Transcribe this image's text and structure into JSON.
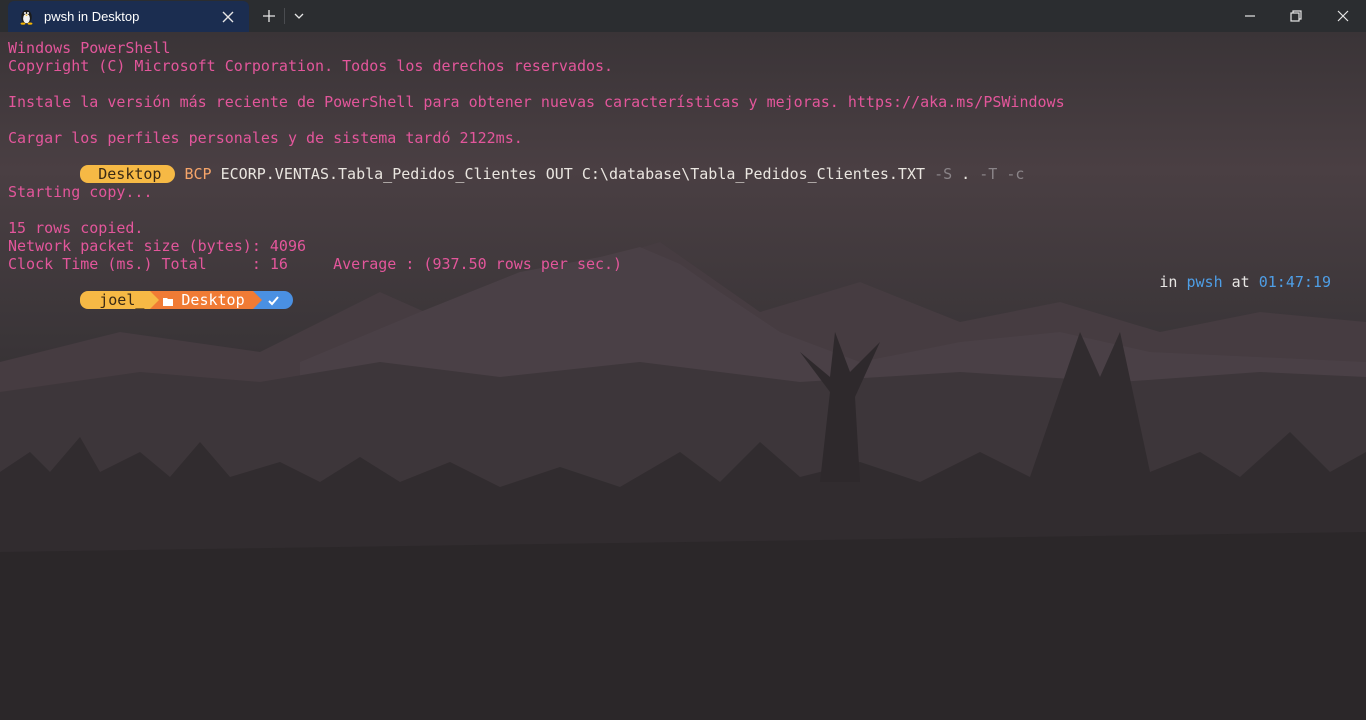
{
  "tab": {
    "title": "pwsh in Desktop",
    "icon": "linux-penguin-icon"
  },
  "titlebar": {
    "new_tab_icon": "plus-icon",
    "dropdown_icon": "chevron-down-icon",
    "minimize_icon": "minimize-icon",
    "restore_icon": "restore-icon",
    "close_icon": "close-icon"
  },
  "terminal": {
    "lines": [
      "Windows PowerShell",
      "Copyright (C) Microsoft Corporation. Todos los derechos reservados.",
      "",
      "Instale la versión más reciente de PowerShell para obtener nuevas características y mejoras. https://aka.ms/PSWindows",
      "",
      "Cargar los perfiles personales y de sistema tardó 2122ms."
    ],
    "command_prompt": {
      "segment": "Desktop",
      "cmd": "BCP",
      "args": "ECORP.VENTAS.Tabla_Pedidos_Clientes OUT C:\\database\\Tabla_Pedidos_Clientes.TXT",
      "flag_s": "-S",
      "dot": ".",
      "flag_t": "-T",
      "flag_c": "-c"
    },
    "output": [
      "",
      "Starting copy...",
      "",
      "15 rows copied.",
      "Network packet size (bytes): 4096",
      "Clock Time (ms.) Total     : 16     Average : (937.50 rows per sec.)"
    ],
    "prompt": {
      "user": "joel_",
      "folder": "Desktop",
      "folder_icon": "folder-icon",
      "status_icon": "checkmark-icon",
      "right_in": "in",
      "right_shell": "pwsh",
      "right_at": "at",
      "right_time": "01:47:19"
    }
  },
  "colors": {
    "text_pink": "#e3569b",
    "tab_active": "#1b2d50",
    "segment_yellow": "#f6b945",
    "segment_orange": "#f07b35",
    "segment_blue": "#4a90e2",
    "highlight_blue": "#4e9ee6"
  }
}
